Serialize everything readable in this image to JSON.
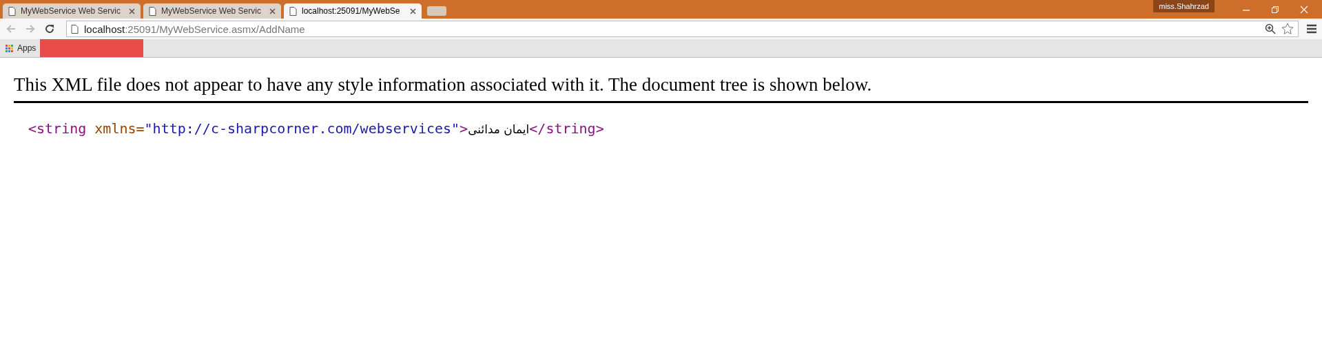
{
  "tabs": [
    {
      "title": "MyWebService Web Servic",
      "selected": false
    },
    {
      "title": "MyWebService Web Servic",
      "selected": false
    },
    {
      "title": "localhost:25091/MyWebSe",
      "selected": true
    }
  ],
  "profile": "miss.Shahrzad",
  "address": {
    "host": "localhost",
    "path": ":25091/MyWebService.asmx/AddName"
  },
  "bookmarks": {
    "apps": "Apps"
  },
  "notice": "This XML file does not appear to have any style information associated with it. The document tree is shown below.",
  "xml_line": {
    "open_tag": "<string",
    "attr_name": "xmlns=",
    "attr_value": "\"http://c-sharpcorner.com/webservices\"",
    "open_end": ">",
    "text": "ایمان مدائنی",
    "close_tag": "</string>"
  }
}
